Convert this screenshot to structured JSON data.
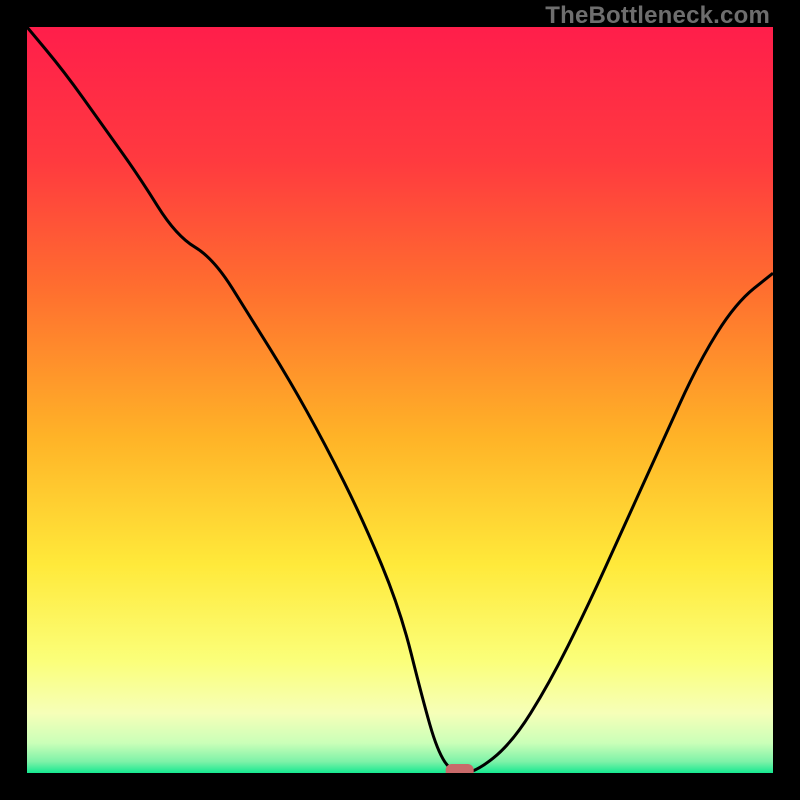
{
  "watermark": "TheBottleneck.com",
  "chart_data": {
    "type": "line",
    "title": "",
    "xlabel": "",
    "ylabel": "",
    "xlim": [
      0,
      100
    ],
    "ylim": [
      0,
      100
    ],
    "grid": false,
    "legend": false,
    "series": [
      {
        "name": "bottleneck-curve",
        "x": [
          0,
          5,
          10,
          15,
          20,
          25,
          30,
          35,
          40,
          45,
          50,
          53,
          55,
          57,
          60,
          65,
          70,
          75,
          80,
          85,
          90,
          95,
          100
        ],
        "y": [
          100,
          94,
          87,
          80,
          72,
          69,
          61,
          53,
          44,
          34,
          22,
          10,
          3,
          0,
          0,
          4,
          12,
          22,
          33,
          44,
          55,
          63,
          67
        ]
      }
    ],
    "marker": {
      "x": 58,
      "y": 0,
      "color": "#c96a6a"
    },
    "gradient_stops": [
      {
        "pos": 0.0,
        "color": "#ff1e4b"
      },
      {
        "pos": 0.18,
        "color": "#ff3a3f"
      },
      {
        "pos": 0.35,
        "color": "#ff6e2f"
      },
      {
        "pos": 0.55,
        "color": "#ffb327"
      },
      {
        "pos": 0.72,
        "color": "#ffe93a"
      },
      {
        "pos": 0.85,
        "color": "#fbff7a"
      },
      {
        "pos": 0.92,
        "color": "#f6ffb8"
      },
      {
        "pos": 0.96,
        "color": "#caffb8"
      },
      {
        "pos": 0.985,
        "color": "#7df2a8"
      },
      {
        "pos": 1.0,
        "color": "#15e890"
      }
    ]
  }
}
